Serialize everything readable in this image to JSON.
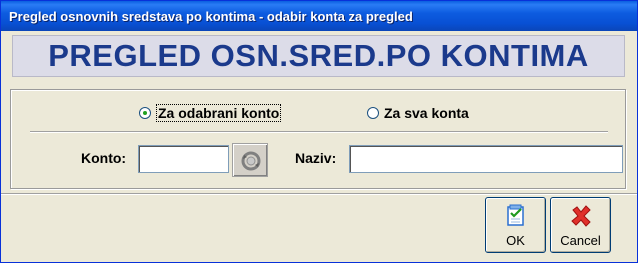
{
  "window": {
    "title": "Pregled osnovnih sredstava po kontima - odabir konta za pregled"
  },
  "banner": {
    "text": "PREGLED OSN.SRED.PO KONTIMA"
  },
  "options": {
    "selected": "Za odabrani konto",
    "radio_selected_label": "Za odabrani konto",
    "radio_all_label": "Za sva konta"
  },
  "fields": {
    "konto_label": "Konto:",
    "konto_value": "",
    "naziv_label": "Naziv:",
    "naziv_value": ""
  },
  "buttons": {
    "ok_label": "OK",
    "cancel_label": "Cancel"
  },
  "colors": {
    "titlebar": "#0a5fe0",
    "banner_text": "#1b3a8c",
    "banner_bg": "#dcdce8",
    "radio_dot": "#21a121",
    "cancel_icon": "#e0302a",
    "ok_icon": "#2a6fd0"
  },
  "icons": {
    "lookup": "refresh-lookup-icon",
    "ok": "check-document-icon",
    "cancel": "red-x-icon"
  }
}
